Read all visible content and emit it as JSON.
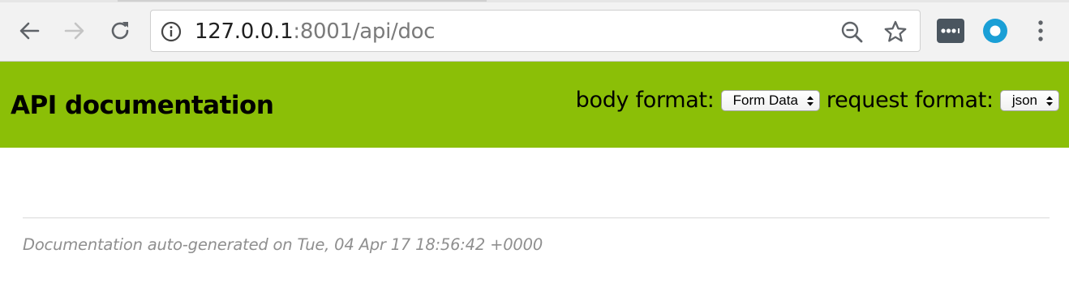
{
  "browser": {
    "url_host": "127.0.0.1",
    "url_rest": ":8001/api/doc",
    "icons": {
      "back": "arrow-left-icon",
      "forward": "arrow-right-icon",
      "reload": "reload-icon",
      "info": "info-icon",
      "zoom": "zoom-out-icon",
      "bookmark": "star-icon",
      "extension_1": "lastpass-icon",
      "extension_2": "circle-extension-icon",
      "menu": "three-dots-icon"
    }
  },
  "header": {
    "title": "API documentation",
    "background_color": "#8bbf07",
    "body_format_label": "body format:",
    "body_format_value": "Form Data",
    "request_format_label": "request format:",
    "request_format_value": "json"
  },
  "footer": {
    "note": "Documentation auto-generated on Tue, 04 Apr 17 18:56:42 +0000"
  }
}
